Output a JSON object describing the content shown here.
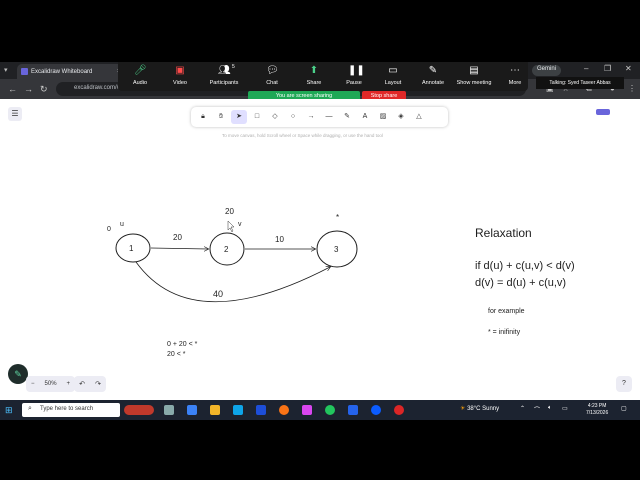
{
  "browser": {
    "tab_title": "Excalidraw Whiteboard",
    "url": "excalidraw.com/#room=...",
    "gemini_label": "Gemini"
  },
  "zoom": {
    "items": [
      {
        "label": "Audio",
        "icon": "mic-icon"
      },
      {
        "label": "Video",
        "icon": "video-off-icon"
      },
      {
        "label": "Participants",
        "icon": "participants-icon",
        "count": "5"
      },
      {
        "label": "Chat",
        "icon": "chat-icon"
      },
      {
        "label": "Share",
        "icon": "share-icon"
      },
      {
        "label": "Pause",
        "icon": "pause-icon"
      },
      {
        "label": "Layout",
        "icon": "layout-icon"
      },
      {
        "label": "Annotate",
        "icon": "annotate-icon"
      },
      {
        "label": "Show meeting",
        "icon": "show-meeting-icon"
      },
      {
        "label": "More",
        "icon": "more-icon"
      }
    ],
    "sharing_status": "You are screen sharing",
    "stop_share": "Stop share",
    "talking": "Talking: Syed Taseer Abbas"
  },
  "excalidraw": {
    "hint": "To move canvas, hold Scroll wheel or Space while dragging, or use the hand tool",
    "zoom_level": "50%",
    "zoom_minus": "−",
    "zoom_plus": "+"
  },
  "drawing": {
    "nodes": [
      {
        "label": "1",
        "tag": "u",
        "dist": "0"
      },
      {
        "label": "2",
        "tag": "v",
        "dist": "20"
      },
      {
        "label": "3",
        "tag": "",
        "dist": "*"
      }
    ],
    "edges": [
      {
        "from": "1",
        "to": "2",
        "weight": "20"
      },
      {
        "from": "2",
        "to": "3",
        "weight": "10"
      },
      {
        "from": "1",
        "to": "3",
        "weight": "40"
      }
    ],
    "calc_line1": "0 + 20 < *",
    "calc_line2": "20 < *",
    "title": "Relaxation",
    "rule_line1": "if d(u) + c(u,v) < d(v)",
    "rule_line2": "d(v) = d(u) + c(u,v)",
    "example_label": "for example",
    "infinity_note": "*    = inifinity"
  },
  "taskbar": {
    "search_placeholder": "Type here to search",
    "weather": "38°C  Sunny",
    "time": "4:23 PM",
    "date": "7/13/2026"
  }
}
